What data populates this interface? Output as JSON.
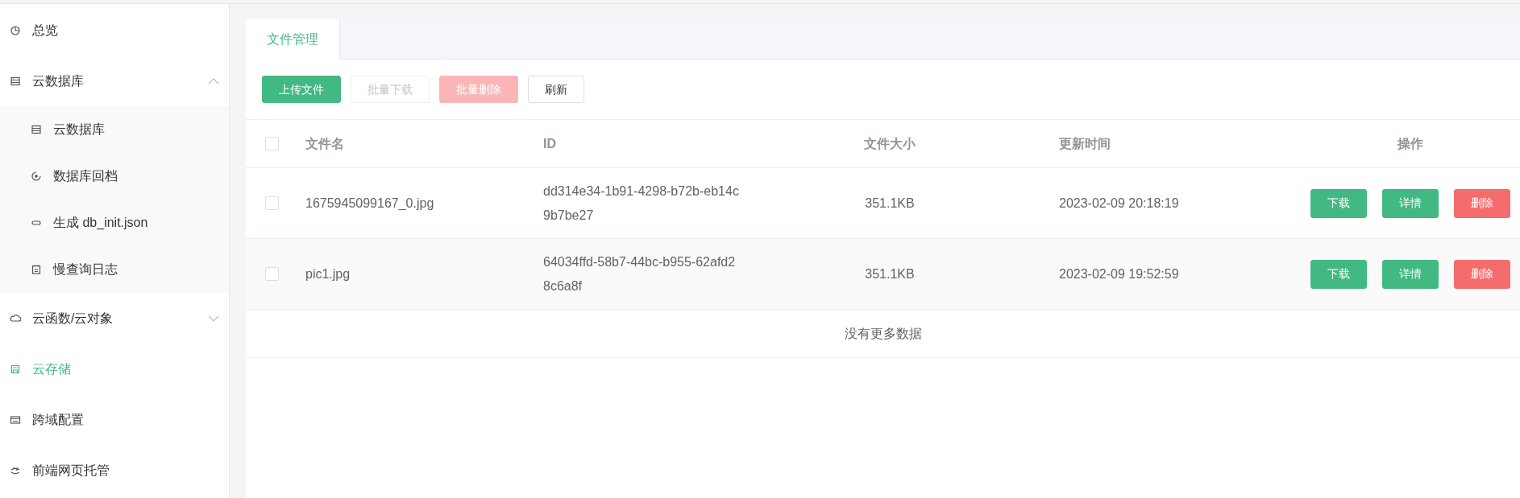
{
  "sidebar": {
    "items": [
      {
        "label": "总览",
        "selected": false
      },
      {
        "label": "云数据库",
        "selected": false,
        "expanded": true,
        "children": [
          {
            "label": "云数据库",
            "selected": false
          },
          {
            "label": "数据库回档",
            "selected": false
          },
          {
            "label": "生成 db_init.json",
            "selected": false
          },
          {
            "label": "慢查询日志",
            "selected": false
          }
        ]
      },
      {
        "label": "云函数/云对象",
        "selected": false,
        "expanded": false
      },
      {
        "label": "云存储",
        "selected": true
      },
      {
        "label": "跨域配置",
        "selected": false
      },
      {
        "label": "前端网页托管",
        "selected": false
      }
    ]
  },
  "tabs": [
    {
      "label": "文件管理",
      "selected": true
    }
  ],
  "toolbar": [
    {
      "label": "上传文件",
      "kind": "primary",
      "disabled": false
    },
    {
      "label": "批量下载",
      "kind": "plain",
      "disabled": true
    },
    {
      "label": "批量删除",
      "kind": "danger",
      "disabled": true
    },
    {
      "label": "刷新",
      "kind": "plain",
      "disabled": false
    }
  ],
  "table": {
    "select_all": {
      "checked": false
    },
    "columns": [
      "文件名",
      "ID",
      "文件大小",
      "更新时间",
      "操作"
    ],
    "rows": [
      {
        "checked": false,
        "name": "1675945099167_0.jpg",
        "id": [
          "dd314e34-1b91-4298-b72b-eb14c",
          "9b7be27"
        ],
        "size": "351.1KB",
        "updated": "2023-02-09 20:18:19",
        "actions": [
          {
            "label": "下载",
            "kind": "primary"
          },
          {
            "label": "详情",
            "kind": "primary"
          },
          {
            "label": "删除",
            "kind": "danger"
          }
        ]
      },
      {
        "checked": false,
        "name": "pic1.jpg",
        "id": [
          "64034ffd-58b7-44bc-b955-62afd2",
          "8c6a8f"
        ],
        "size": "351.1KB",
        "updated": "2023-02-09 19:52:59",
        "actions": [
          {
            "label": "下载",
            "kind": "primary"
          },
          {
            "label": "详情",
            "kind": "primary"
          },
          {
            "label": "删除",
            "kind": "danger"
          }
        ]
      }
    ],
    "footer": "没有更多数据"
  }
}
